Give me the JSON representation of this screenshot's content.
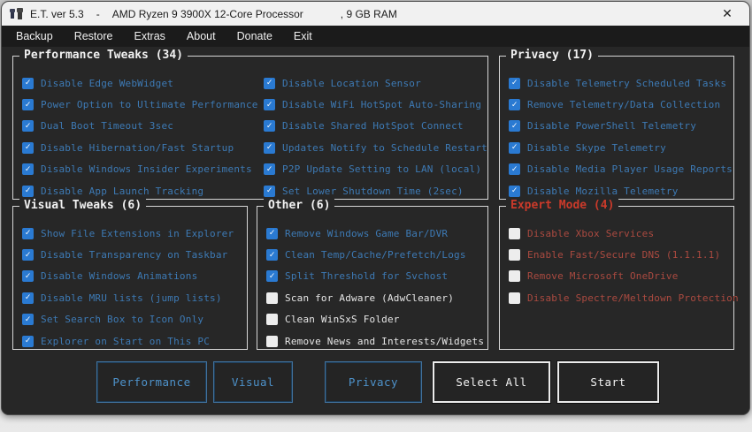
{
  "window": {
    "title_app": "E.T. ver 5.3",
    "title_sep": "-",
    "title_cpu": "AMD Ryzen 9 3900X 12-Core Processor",
    "title_ram": ", 9 GB RAM",
    "close_glyph": "✕"
  },
  "menu": {
    "items": [
      "Backup",
      "Restore",
      "Extras",
      "About",
      "Donate",
      "Exit"
    ]
  },
  "colors": {
    "checked_box": "#2a7ad2",
    "checked_label": "#3d7ab5",
    "unchecked_label": "#e6e6e6",
    "expert_red": "#cb3a2a",
    "expert_item_red": "#ab4a40",
    "blue_button": "#4e93cc",
    "white_button": "#f3f3f3"
  },
  "groups": {
    "performance": {
      "title": "Performance Tweaks (34)",
      "col1": [
        {
          "label": "Disable Edge WebWidget",
          "checked": true
        },
        {
          "label": "Power Option to Ultimate Performance",
          "checked": true
        },
        {
          "label": "Dual Boot Timeout 3sec",
          "checked": true
        },
        {
          "label": "Disable Hibernation/Fast Startup",
          "checked": true
        },
        {
          "label": "Disable Windows Insider Experiments",
          "checked": true
        },
        {
          "label": "Disable App Launch Tracking",
          "checked": true
        }
      ],
      "col2": [
        {
          "label": "Disable Location Sensor",
          "checked": true
        },
        {
          "label": "Disable WiFi HotSpot Auto-Sharing",
          "checked": true
        },
        {
          "label": "Disable Shared HotSpot Connect",
          "checked": true
        },
        {
          "label": "Updates Notify to Schedule Restart",
          "checked": true
        },
        {
          "label": "P2P Update Setting to LAN (local)",
          "checked": true
        },
        {
          "label": "Set Lower Shutdown Time (2sec)",
          "checked": true
        }
      ]
    },
    "privacy": {
      "title": "Privacy (17)",
      "items": [
        {
          "label": "Disable Telemetry Scheduled Tasks",
          "checked": true
        },
        {
          "label": "Remove Telemetry/Data Collection",
          "checked": true
        },
        {
          "label": "Disable PowerShell Telemetry",
          "checked": true
        },
        {
          "label": "Disable Skype Telemetry",
          "checked": true
        },
        {
          "label": "Disable Media Player Usage Reports",
          "checked": true
        },
        {
          "label": "Disable Mozilla Telemetry",
          "checked": true
        }
      ]
    },
    "visual": {
      "title": "Visual Tweaks (6)",
      "items": [
        {
          "label": "Show File Extensions in Explorer",
          "checked": true
        },
        {
          "label": "Disable Transparency on Taskbar",
          "checked": true
        },
        {
          "label": "Disable Windows Animations",
          "checked": true
        },
        {
          "label": "Disable MRU lists (jump lists)",
          "checked": true
        },
        {
          "label": "Set Search Box to Icon Only",
          "checked": true
        },
        {
          "label": "Explorer on Start on This PC",
          "checked": true
        }
      ]
    },
    "other": {
      "title": "Other (6)",
      "items": [
        {
          "label": "Remove Windows Game Bar/DVR",
          "checked": true
        },
        {
          "label": "Clean Temp/Cache/Prefetch/Logs",
          "checked": true
        },
        {
          "label": "Split Threshold for Svchost",
          "checked": true
        },
        {
          "label": "Scan for Adware (AdwCleaner)",
          "checked": false
        },
        {
          "label": "Clean WinSxS Folder",
          "checked": false
        },
        {
          "label": "Remove News and Interests/Widgets",
          "checked": false
        }
      ]
    },
    "expert": {
      "title": "Expert Mode (4)",
      "items": [
        {
          "label": "Disable Xbox Services",
          "checked": false
        },
        {
          "label": "Enable Fast/Secure DNS (1.1.1.1)",
          "checked": false
        },
        {
          "label": "Remove Microsoft OneDrive",
          "checked": false
        },
        {
          "label": "Disable Spectre/Meltdown Protection",
          "checked": false
        }
      ]
    }
  },
  "action_buttons": [
    {
      "label": "Performance",
      "style": "blue"
    },
    {
      "label": "Visual",
      "style": "blue"
    },
    {
      "label": "Privacy",
      "style": "blue"
    },
    {
      "label": "Select All",
      "style": "white"
    },
    {
      "label": "Start",
      "style": "white"
    }
  ]
}
